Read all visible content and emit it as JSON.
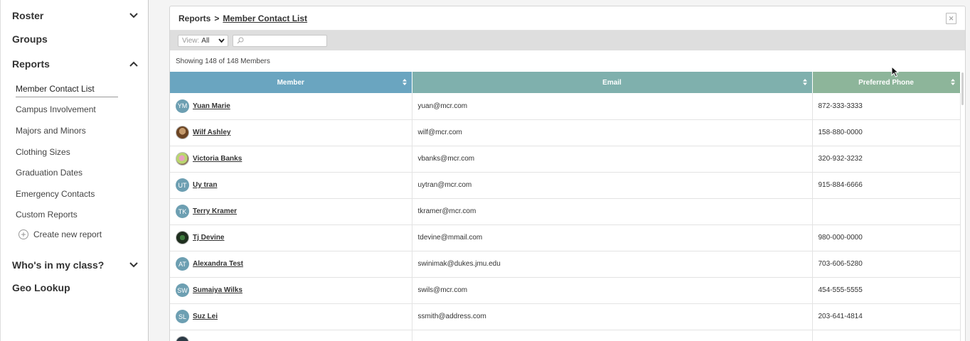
{
  "sidebar": {
    "sections": [
      {
        "label": "Roster",
        "state": "collapsed"
      },
      {
        "label": "Groups"
      },
      {
        "label": "Reports",
        "state": "expanded"
      },
      {
        "label": "Who's in my class?",
        "state": "collapsed"
      },
      {
        "label": "Geo Lookup"
      }
    ],
    "report_items": [
      "Member Contact List",
      "Campus Involvement",
      "Majors and Minors",
      "Clothing Sizes",
      "Graduation Dates",
      "Emergency Contacts",
      "Custom Reports"
    ],
    "create_report_label": "Create new report"
  },
  "header": {
    "breadcrumb_root": "Reports",
    "breadcrumb_separator": ">",
    "breadcrumb_current": "Member Contact List",
    "export_icon": "excel-export-icon"
  },
  "filters": {
    "view_label": "View:",
    "view_value": "All",
    "search_placeholder": ""
  },
  "showing_text": "Showing 148 of 148 Members",
  "table": {
    "columns": [
      "Member",
      "Email",
      "Preferred Phone"
    ],
    "column_colors": [
      "#6aa5c0",
      "#7fb0ad",
      "#8db59a"
    ],
    "rows": [
      {
        "initials": "YM",
        "avatar": "initials",
        "name": "Yuan Marie",
        "email": "yuan@mcr.com",
        "phone": "872-333-3333"
      },
      {
        "initials": "",
        "avatar": "photo1",
        "name": "Wilf Ashley",
        "email": "wilf@mcr.com",
        "phone": "158-880-0000"
      },
      {
        "initials": "",
        "avatar": "photo2",
        "name": "Victoria Banks",
        "email": "vbanks@mcr.com",
        "phone": "320-932-3232"
      },
      {
        "initials": "UT",
        "avatar": "initials",
        "name": "Uy tran",
        "email": "uytran@mcr.com",
        "phone": "915-884-6666"
      },
      {
        "initials": "TK",
        "avatar": "initials",
        "name": "Terry Kramer",
        "email": "tkramer@mcr.com",
        "phone": ""
      },
      {
        "initials": "",
        "avatar": "photo3",
        "name": "Tj Devine",
        "email": "tdevine@mmail.com",
        "phone": "980-000-0000"
      },
      {
        "initials": "AT",
        "avatar": "initials",
        "name": "Alexandra Test",
        "email": "swinimak@dukes.jmu.edu",
        "phone": "703-606-5280"
      },
      {
        "initials": "SW",
        "avatar": "initials",
        "name": "Sumaiya Wilks",
        "email": "swils@mcr.com",
        "phone": "454-555-5555"
      },
      {
        "initials": "SL",
        "avatar": "initials",
        "name": "Suz Lei",
        "email": "ssmith@address.com",
        "phone": "203-641-4814"
      },
      {
        "initials": "",
        "avatar": "photo4",
        "name": "",
        "email": "",
        "phone": ""
      }
    ]
  }
}
